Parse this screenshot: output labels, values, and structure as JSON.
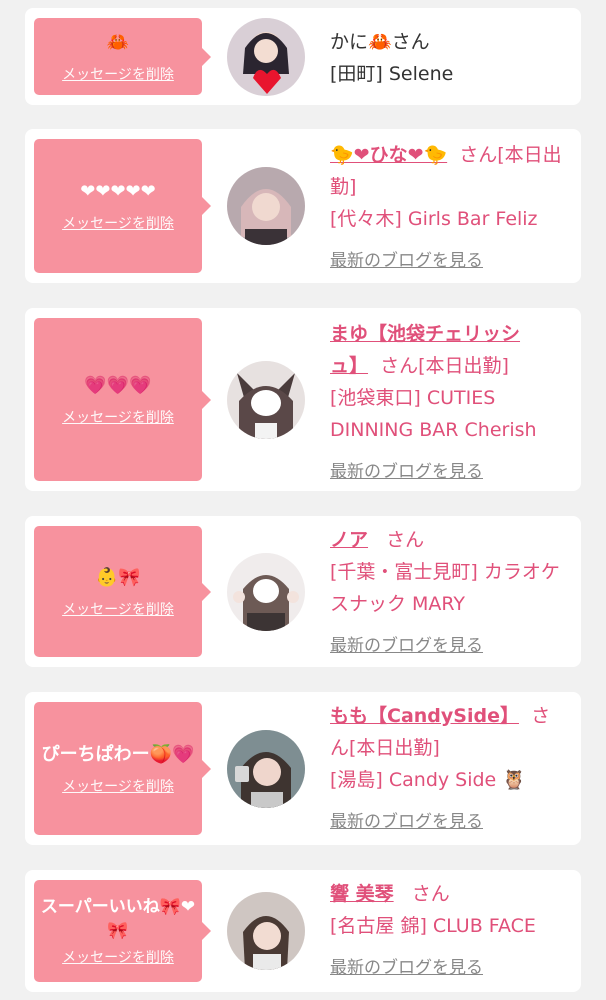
{
  "delete_label": "メッセージを削除",
  "blog_label": "最新のブログを見る",
  "cards": [
    {
      "message": "🦀",
      "name": "かに🦀",
      "suffix": "さん",
      "shop": "[田町] Selene"
    },
    {
      "message": "❤❤❤❤❤",
      "name": "🐤❤ひな❤🐤",
      "suffix": "さん[本日出勤]",
      "shop": "[代々木] Girls Bar Feliz"
    },
    {
      "message": "💗💗💗",
      "name": "まゆ【池袋チェリッシュ】",
      "suffix": "さん[本日出勤]",
      "shop": "[池袋東口] CUTIES DINNING BAR Cherish"
    },
    {
      "message": "👶🎀",
      "name": "ノア",
      "suffix": "さん",
      "shop": "[千葉・富士見町] カラオケスナック MARY"
    },
    {
      "message": "ぴーちぱわー🍑💗",
      "name": "もも【CandySide】",
      "suffix": "さん[本日出勤]",
      "shop": "[湯島] Candy Side 🦉"
    },
    {
      "message": "スーパーいいね🎀❤🎀",
      "name": "響 美琴",
      "suffix": "さん",
      "shop": "[名古屋 錦] CLUB FACE"
    }
  ]
}
